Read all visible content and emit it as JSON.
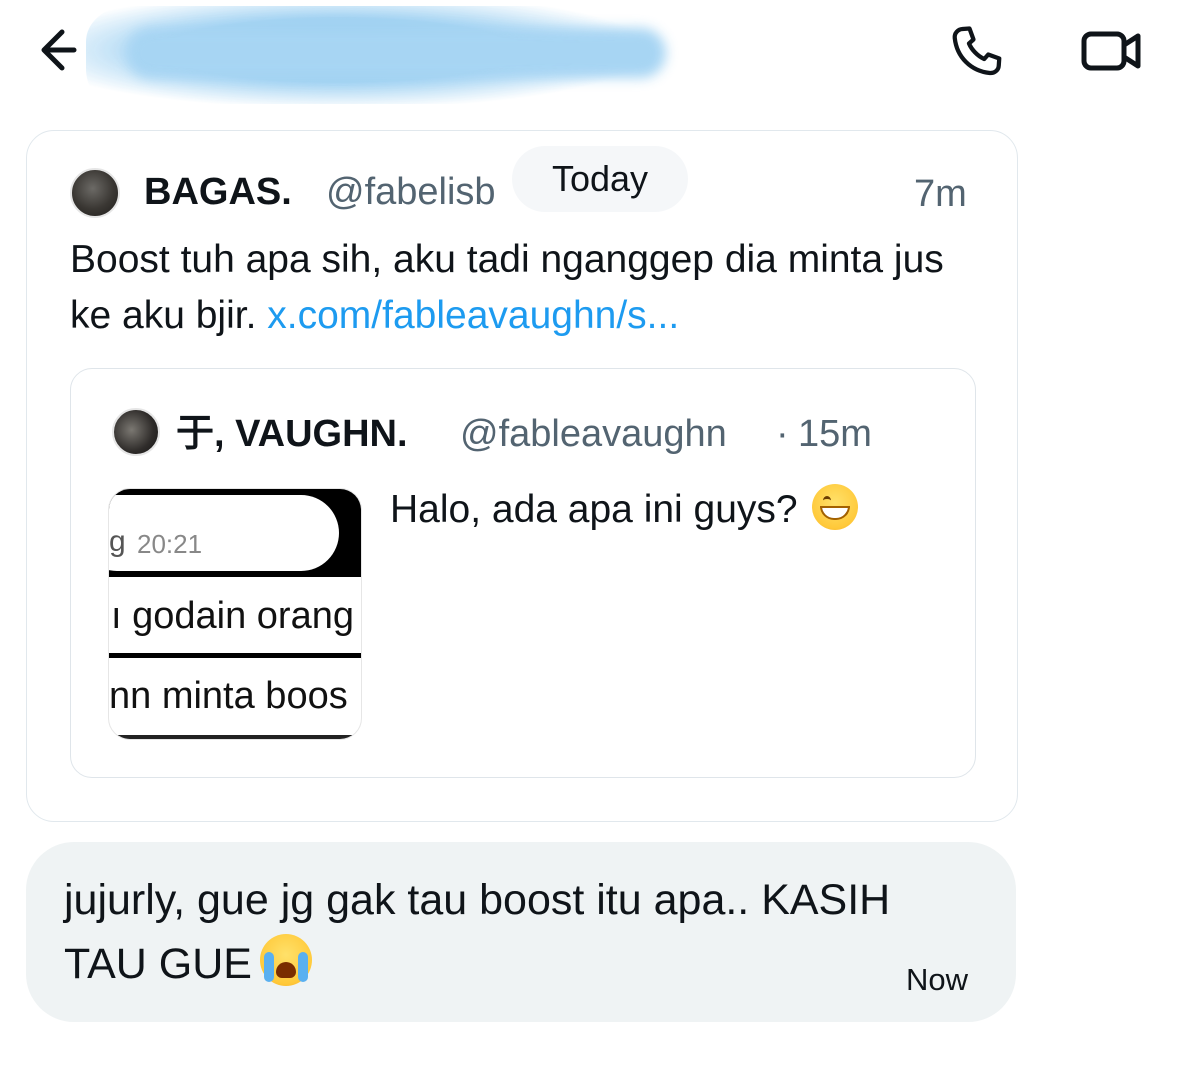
{
  "header": {
    "back_icon": "arrow-left-icon",
    "phone_icon": "phone-icon",
    "video_icon": "video-camera-icon"
  },
  "date_separator": "Today",
  "shared_tweet": {
    "author_name": "BAGAS.",
    "author_handle": "@fabelisb",
    "time": "7m",
    "text": "Boost tuh apa sih, aku tadi nganggep dia minta jus ke aku bjir.",
    "link_text": "x.com/fableavaughn/s...",
    "quoted": {
      "author_name": "于, VAUGHN.",
      "author_handle": "@fableavaughn",
      "separator": "·",
      "time": "15m",
      "text": "Halo, ada apa ini guys?",
      "media": {
        "cut_letter": "g",
        "time": "20:21",
        "line1": "ı godain orang",
        "line2": "nn minta boos"
      }
    }
  },
  "message": {
    "text": "jujurly, gue jg gak tau boost itu apa.. KASIH TAU GUE",
    "time": "Now"
  }
}
